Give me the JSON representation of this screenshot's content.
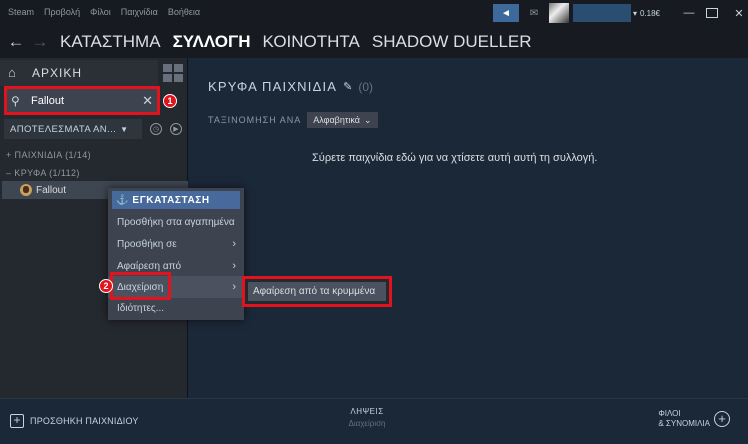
{
  "menu": [
    "Steam",
    "Προβολή",
    "Φίλοι",
    "Παιχνίδια",
    "Βοήθεια"
  ],
  "wallet": "0.18€",
  "nav": {
    "back": "←",
    "forward": "→",
    "items": [
      "ΚΑΤΑΣΤΗΜΑ",
      "ΣΥΛΛΟΓΗ",
      "ΚΟΙΝΟΤΗΤΑ",
      "SHADOW DUELLER"
    ]
  },
  "sidebar": {
    "home_label": "ΑΡΧΙΚΗ",
    "search_value": "Fallout",
    "filter_label": "ΑΠΟΤΕΛΕΣΜΑΤΑ ΑΝ...",
    "categories": [
      {
        "label": "+ ΠΑΙΧΝΙΔΙΑ",
        "count": "(1/14)"
      },
      {
        "label": "– ΚΡΥΦΑ",
        "count": "(1/112)"
      }
    ],
    "game": "Fallout"
  },
  "main": {
    "title": "ΚΡΥΦΑ ΠΑΙΧΝΙΔΙΑ",
    "count": "(0)",
    "sort_label": "ΤΑΞΙΝΟΜΗΣΗ ΑΝΑ",
    "sort_value": "Αλφαβητικά",
    "empty_message": "Σύρετε παιχνίδια εδώ για να χτίσετε αυτή αυτή τη συλλογή."
  },
  "context_menu": {
    "install": "⚓ ΕΓΚΑΤΑΣΤΑΣΗ",
    "items": [
      "Προσθήκη στα αγαπημένα",
      "Προσθήκη σε",
      "Αφαίρεση από",
      "Διαχείριση",
      "Ιδιότητες..."
    ],
    "submenu_item": "Αφαίρεση από τα κρυμμένα"
  },
  "annotations": [
    "1",
    "2"
  ],
  "footer": {
    "add_game": "ΠΡΟΣΘΗΚΗ ΠΑΙΧΝΙΔΙΟΥ",
    "downloads_title": "ΛΗΨΕΙΣ",
    "downloads_sub": "Διαχείριση",
    "friends_line1": "ΦΙΛΟΙ",
    "friends_line2": "& ΣΥΝΟΜΙΛΙΑ"
  },
  "colors": {
    "background": "#1b2838",
    "header": "#171a21",
    "sidebar": "#24282f",
    "accent": "#47699c",
    "annotation_red": "#e2131d"
  }
}
